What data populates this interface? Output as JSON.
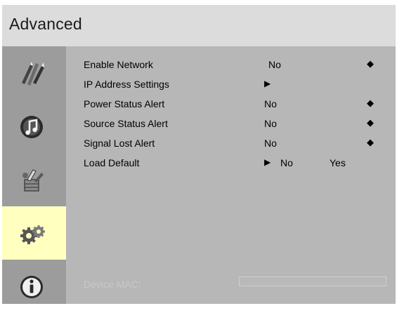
{
  "header": {
    "title": "Advanced"
  },
  "sidebar": {
    "items": [
      {
        "icon": "pencil-tools-icon",
        "active": false
      },
      {
        "icon": "audio-note-icon",
        "active": false
      },
      {
        "icon": "tools-icon",
        "active": false
      },
      {
        "icon": "gears-icon",
        "active": true
      },
      {
        "icon": "info-icon",
        "active": false
      }
    ]
  },
  "settings": [
    {
      "label": "Enable Network",
      "value": "No"
    },
    {
      "label": "IP Address Settings",
      "value": ""
    },
    {
      "label": "Power Status Alert",
      "value": "No"
    },
    {
      "label": "Source Status Alert",
      "value": "No"
    },
    {
      "label": "Signal Lost Alert",
      "value": "No"
    },
    {
      "label": "Load Default",
      "options": [
        "No",
        "Yes"
      ]
    }
  ],
  "symbols": {
    "arrow": "▶",
    "diamond": "◆"
  },
  "device_mac": {
    "label": "Device MAC:",
    "value": ""
  },
  "colors": {
    "header_bg": "#dcdcdc",
    "panel_bg": "#b7b7b7",
    "sidebar_bg": "#9c9c9c",
    "active_item_bg": "#ffffc0",
    "disabled_text": "#c8c8c8"
  }
}
